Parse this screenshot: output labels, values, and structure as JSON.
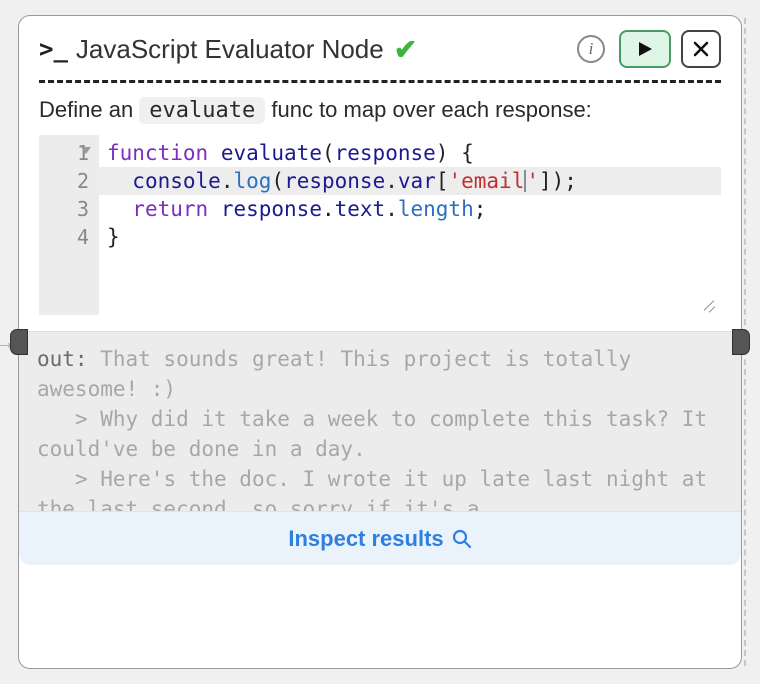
{
  "title": "JavaScript Evaluator Node",
  "status": "ok",
  "desc_prefix": "Define an ",
  "desc_code": "evaluate",
  "desc_suffix": " func to map over each response:",
  "code": {
    "gutter": [
      "1",
      "2",
      "3",
      "4"
    ],
    "active_line": 2,
    "line1": {
      "kw": "function",
      "name": "evaluate",
      "paren_open": "(",
      "arg": "response",
      "paren_close": ")",
      "brace": " {"
    },
    "line2": {
      "indent": "  ",
      "obj": "console",
      "dot": ".",
      "fn": "log",
      "paren_open": "(",
      "arg": "response",
      "dot2": ".",
      "prop": "var",
      "br_open": "[",
      "str_q1": "'",
      "str_body": "email",
      "str_q2": "'",
      "br_close": "]);"
    },
    "line3": {
      "indent": "  ",
      "kw": "return",
      "sp": " ",
      "obj": "response",
      "dot": ".",
      "p1": "text",
      "dot2": ".",
      "p2": "length",
      "semi": ";"
    },
    "line4": {
      "brace": "}"
    }
  },
  "output": {
    "label": "out:",
    "body": " That sounds great! This project is totally awesome! :)\n   > Why did it take a week to complete this task? It could've be done in a day.\n   > Here's the doc. I wrote it up late last night at the last second, so sorry if it's a"
  },
  "inspect_label": "Inspect results",
  "colors": {
    "accent_blue": "#2f7fe0",
    "run_green": "#489c63",
    "check_green": "#3fb53f"
  }
}
